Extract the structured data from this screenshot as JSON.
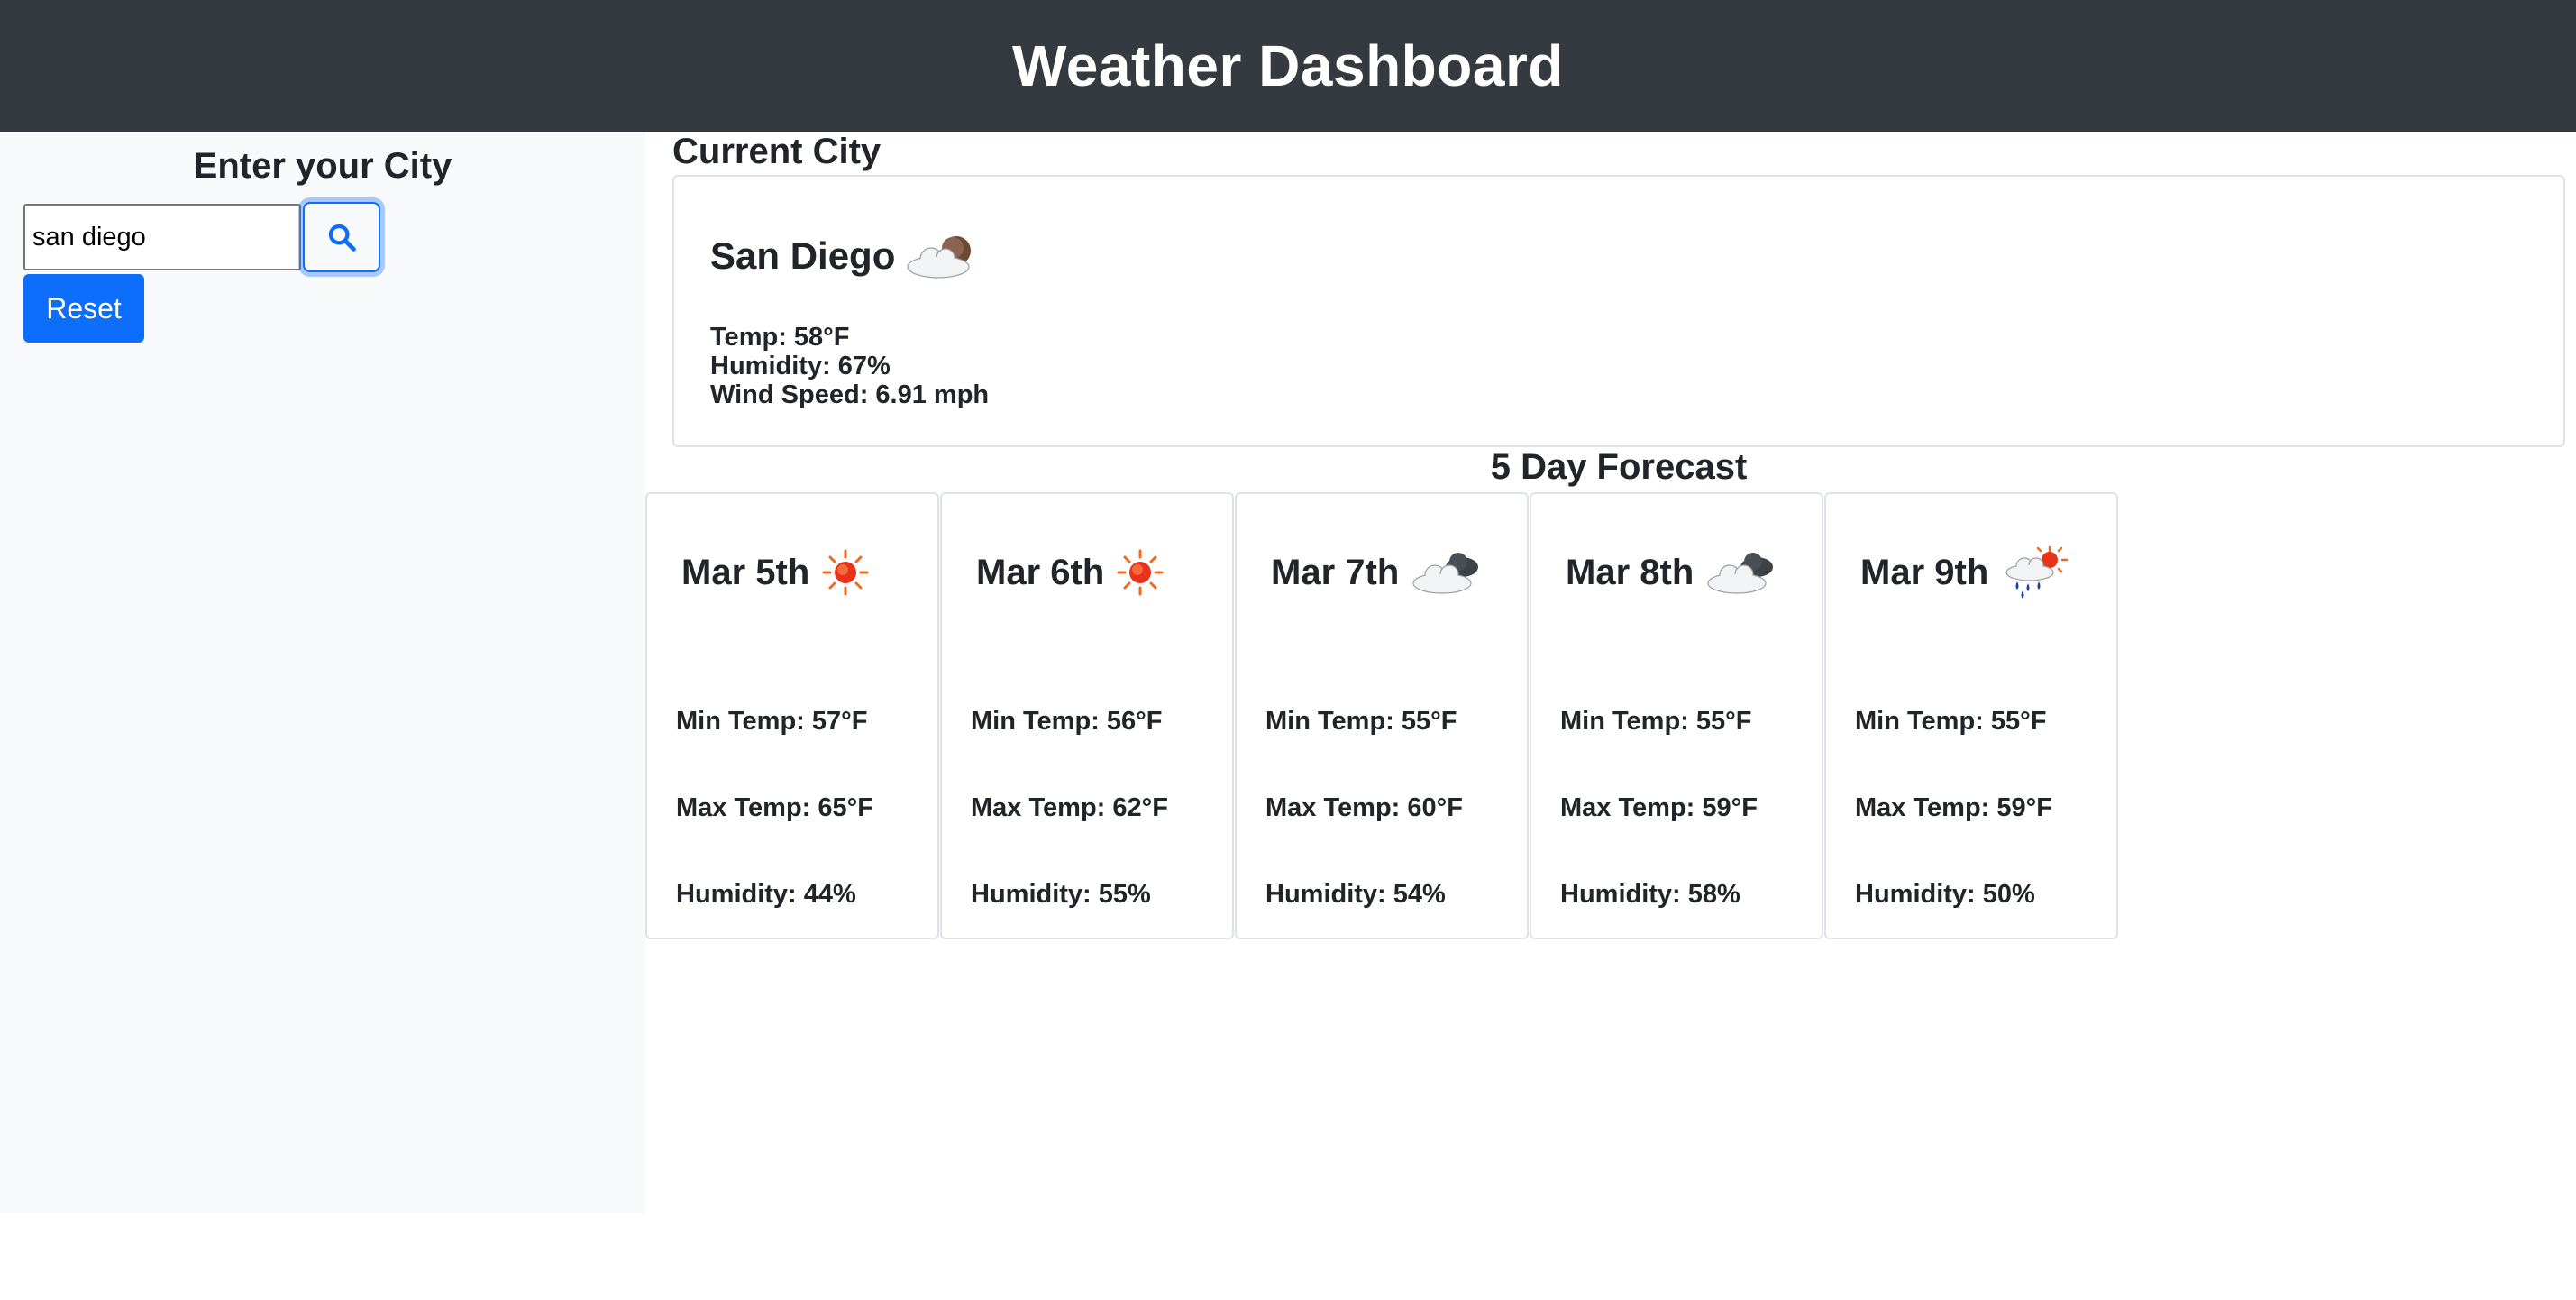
{
  "header": {
    "title": "Weather Dashboard"
  },
  "sidebar": {
    "heading": "Enter your City",
    "search": {
      "value": "san diego",
      "placeholder": "",
      "icon": "search-icon"
    },
    "reset_label": "Reset"
  },
  "current": {
    "heading": "Current City",
    "city": "San Diego",
    "icon": "cloud-moon-icon",
    "temp": "Temp: 58°F",
    "humidity": "Humidity: 67%",
    "wind": "Wind Speed: 6.91 mph"
  },
  "forecast": {
    "heading": "5 Day Forecast",
    "days": [
      {
        "date": "Mar 5th",
        "icon": "sun-icon",
        "min": "Min Temp: 57°F",
        "max": "Max Temp: 65°F",
        "humidity": "Humidity: 44%"
      },
      {
        "date": "Mar 6th",
        "icon": "sun-icon",
        "min": "Min Temp: 56°F",
        "max": "Max Temp: 62°F",
        "humidity": "Humidity: 55%"
      },
      {
        "date": "Mar 7th",
        "icon": "cloud-icon",
        "min": "Min Temp: 55°F",
        "max": "Max Temp: 60°F",
        "humidity": "Humidity: 54%"
      },
      {
        "date": "Mar 8th",
        "icon": "cloud-icon",
        "min": "Min Temp: 55°F",
        "max": "Max Temp: 59°F",
        "humidity": "Humidity: 58%"
      },
      {
        "date": "Mar 9th",
        "icon": "rain-sun-icon",
        "min": "Min Temp: 55°F",
        "max": "Max Temp: 59°F",
        "humidity": "Humidity: 50%"
      }
    ]
  },
  "colors": {
    "header_bg": "#343a40",
    "sidebar_bg": "#f8f9fa",
    "accent": "#0d6efd",
    "text": "#212529"
  }
}
